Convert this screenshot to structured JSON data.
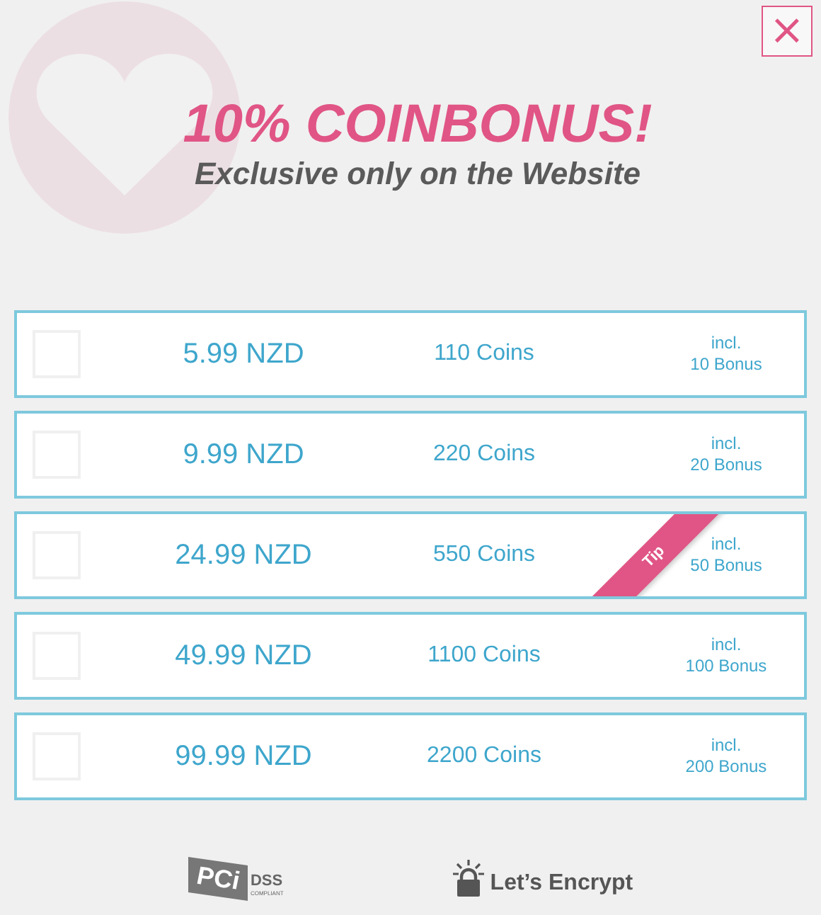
{
  "close_button": {
    "label": "×"
  },
  "header": {
    "title": "10% COINBONUS!",
    "subtitle": "Exclusive only on the Website"
  },
  "packages": [
    {
      "price": "5.99 NZD",
      "coins": "110 Coins",
      "bonus_prefix": "incl.",
      "bonus": "10 Bonus",
      "checked": false
    },
    {
      "price": "9.99 NZD",
      "coins": "220 Coins",
      "bonus_prefix": "incl.",
      "bonus": "20 Bonus",
      "checked": false
    },
    {
      "price": "24.99 NZD",
      "coins": "550 Coins",
      "bonus_prefix": "incl.",
      "bonus": "50 Bonus",
      "checked": false,
      "ribbon": "Tip"
    },
    {
      "price": "49.99 NZD",
      "coins": "1100 Coins",
      "bonus_prefix": "incl.",
      "bonus": "100 Bonus",
      "checked": false
    },
    {
      "price": "99.99 NZD",
      "coins": "2200 Coins",
      "bonus_prefix": "incl.",
      "bonus": "200 Bonus",
      "checked": false
    }
  ],
  "footer": {
    "pci": {
      "mark": "PCi",
      "dss": "DSS",
      "compliant": "COMPLIANT"
    },
    "encrypt": "Let’s Encrypt"
  }
}
